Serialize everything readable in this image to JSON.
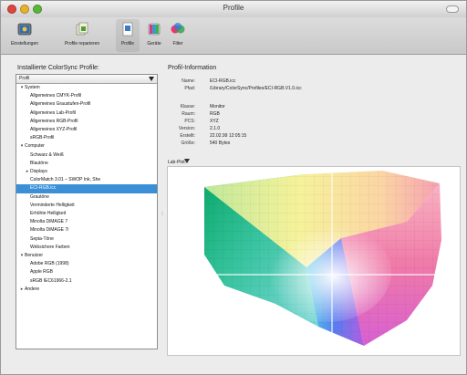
{
  "window": {
    "title": "Profile"
  },
  "toolbar": {
    "items": [
      {
        "label": "Einstellungen",
        "icon": "settings-icon"
      },
      {
        "label": "Profile reparieren",
        "icon": "repair-icon"
      },
      {
        "label": "Profile",
        "icon": "profile-icon"
      },
      {
        "label": "Geräte",
        "icon": "devices-icon"
      },
      {
        "label": "Filter",
        "icon": "filter-icon"
      }
    ]
  },
  "left_pane": {
    "title": "Installierte ColorSync Profile:",
    "header": "Profil",
    "rows": [
      {
        "label": "System",
        "indent": 0,
        "disclosure": "open"
      },
      {
        "label": "Allgemeines CMYK-Profil",
        "indent": 2
      },
      {
        "label": "Allgemeines Graustufen-Profil",
        "indent": 2
      },
      {
        "label": "Allgemeines Lab-Profil",
        "indent": 2
      },
      {
        "label": "Allgemeines RGB-Profil",
        "indent": 2
      },
      {
        "label": "Allgemeines XYZ-Profil",
        "indent": 2
      },
      {
        "label": "sRGB-Profil",
        "indent": 2
      },
      {
        "label": "Computer",
        "indent": 0,
        "disclosure": "open"
      },
      {
        "label": "Schwarz & Weiß",
        "indent": 2
      },
      {
        "label": "Blautöne",
        "indent": 2
      },
      {
        "label": "Displays",
        "indent": 1,
        "disclosure": "closed"
      },
      {
        "label": "ColorMatch 3.01 – SWOP Ink, She",
        "indent": 2
      },
      {
        "label": "ECI-RGB.icc",
        "indent": 2,
        "selected": true
      },
      {
        "label": "Grautöne",
        "indent": 2
      },
      {
        "label": "Verminderte Helligkeit",
        "indent": 2
      },
      {
        "label": "Erhöhte Helligkeit",
        "indent": 2
      },
      {
        "label": "Minolta DiMAGE 7",
        "indent": 2
      },
      {
        "label": "Minolta DiMAGE 7i",
        "indent": 2
      },
      {
        "label": "Sepia-Töne",
        "indent": 2
      },
      {
        "label": "Websichere Farben",
        "indent": 2
      },
      {
        "label": "Benutzer",
        "indent": 0,
        "disclosure": "open"
      },
      {
        "label": "Adobe RGB (1998)",
        "indent": 2
      },
      {
        "label": "Apple RGB",
        "indent": 2
      },
      {
        "label": "sRGB IEC61966-2.1",
        "indent": 2
      },
      {
        "label": "Andere",
        "indent": 0,
        "disclosure": "closed"
      }
    ]
  },
  "info": {
    "title": "Profil-Information",
    "fields": [
      {
        "label": "Name:",
        "value": "ECI-RGB.icc"
      },
      {
        "label": "Pfad:",
        "value": "/Library/ColorSync/Profiles/ECI-RGB.V1.0.icc"
      },
      {
        "label": "Klasse:",
        "value": "Monitor"
      },
      {
        "label": "Raum:",
        "value": "RGB"
      },
      {
        "label": "PCS:",
        "value": "XYZ"
      },
      {
        "label": "Version:",
        "value": "2.1.0"
      },
      {
        "label": "Erstellt:",
        "value": "22.02.99 12:05:15"
      },
      {
        "label": "Größe:",
        "value": "540 Bytes"
      }
    ],
    "plot_label": "Lab-Plot:"
  },
  "colors": {
    "selection": "#3b8fd6",
    "window": "#ececec"
  }
}
